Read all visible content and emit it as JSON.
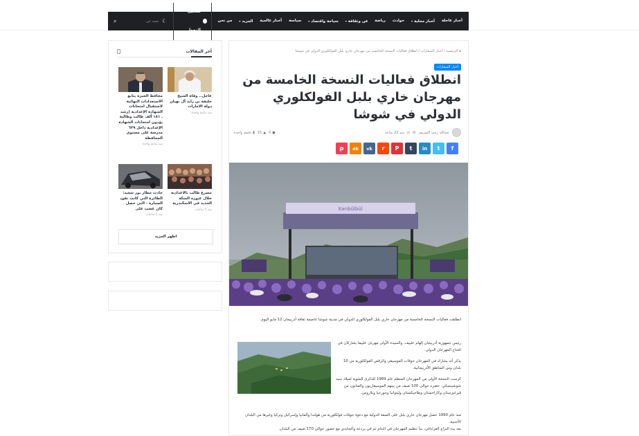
{
  "nav": {
    "menu": [
      {
        "label": "أخبار عاجلة",
        "has_caret": false
      },
      {
        "label": "أخبار محلية",
        "has_caret": true
      },
      {
        "label": "حوادث",
        "has_caret": false
      },
      {
        "label": "رياضة",
        "has_caret": false
      },
      {
        "label": "فن وثقافة",
        "has_caret": true
      },
      {
        "label": "سياحة واقتصاد",
        "has_caret": true
      },
      {
        "label": "سياسة",
        "has_caret": false
      },
      {
        "label": "أخبار عالمية",
        "has_caret": false
      },
      {
        "label": "المزيد",
        "has_caret": true
      },
      {
        "label": "من نحن",
        "has_caret": false
      }
    ],
    "login_label": "تسجيل الدخول",
    "search_placeholder": "بحث عن"
  },
  "article": {
    "breadcrumb": "الرئيسية / أخبار السفارات / انطلاق فعاليات النسخة الخامسة من مهرجان خاري بلبل الفولكلوري الدولي في شوشا",
    "category": "أخبار السفارات",
    "title": "انطلاق فعاليات النسخة الخامسة من مهرجان خاري بلبل الفولكلوري الدولي في شوشا",
    "author": "عبدالله رجب الشريف",
    "time": "منذ 22 ساعة",
    "comments": "0",
    "views": "15",
    "read_time": "دقيقة واحدة",
    "share_buttons": [
      {
        "name": "facebook",
        "glyph": "f",
        "color": "#4080ff"
      },
      {
        "name": "twitter",
        "glyph": "t",
        "color": "#40bff5"
      },
      {
        "name": "linkedin",
        "glyph": "in",
        "color": "#238cc8"
      },
      {
        "name": "tumblr",
        "glyph": "t",
        "color": "#35465c"
      },
      {
        "name": "pinterest",
        "glyph": "P",
        "color": "#e13138"
      },
      {
        "name": "reddit",
        "glyph": "r",
        "color": "#ff4500"
      },
      {
        "name": "vk",
        "glyph": "vk",
        "color": "#45668e"
      },
      {
        "name": "odnoklassniki",
        "glyph": "ok",
        "color": "#ee8208"
      },
      {
        "name": "pocket",
        "glyph": "p",
        "color": "#ef4056"
      }
    ],
    "banner_text": "Xarıbülbül",
    "intro": "انطلقت فعاليات النسخة الخامسة من مهرجان خاري بلبل الفولكلوري الدولي في مدينة شوشا عاصمة ثقافة أذربيجان 12 مايو اليوم.",
    "para1": "رئيس جمهورية أذربيجان إلهام علييف، والسيدة الأولى مهربان علييفا يشاركان في افتتاح المهرجان الدولي.",
    "para2": "يذكر أنه يشارك في المهرجان جوقات الموسيقى والرقص الفولكلورية من 10 بلدان وس المناطق الأذربيجانية.",
    "para3": "كرست النسخة الأولى من المهرجان المنظم عام 1989 للذكرى المئوية لميلاد سيد شوشينسكي. حضره حوالي 100 ضيف من بينهم الموسيقاريون والفنانون من قيرغيزستان وكازاخستان وطاجيكستان وليتوانيا وجورجيا وبلاروس.",
    "para4": "منذ عام 1990 حصل مهرجان خاري بلبل على الصفة الدولية مع دعوة جوقات فولكلورية من هولندا وألمانيا وإسرائيل وتركيا وغيرها من البلدان الأجنبية.",
    "para5": "بعد بدء النزاع الفراباغي، بدأ تنظيم المهرجان في اغدام ثم في بردعه وأغجابدي مع حضور حوالي 170 ضيف من البلدان"
  },
  "sidebar": {
    "widget_title": "آخر المقالات",
    "posts": [
      {
        "title": "عاجل.. وفاة الشيخ خليفة بن زايد آل نهيان دولة الامارات",
        "time": "منذ ساعة واحدة"
      },
      {
        "title": "محافظ الجيزة يتابع الاستعدادات النهائية لاستقبال امتحانات الشهادة الإعدادية (رشد ـ ١٨١ ألف طالب وطالبة يؤدون امتحانات الشهادة الإعدادية داخل ٦٢٩ مدرسة على مستوى المحافظة",
        "time": "منذ ساعة واحدة"
      },
      {
        "title": "مصرع طالب بالاعدادية خلال عبوره السكة الحديد في الاسكندرية",
        "time": "منذ 5 ساعات"
      },
      {
        "title": "حادث مطار بور سعيد: الطائرة التي كانت تقود السيارة - التي حصل كان غضب على",
        "time": "منذ 5 ساعات"
      }
    ],
    "more_label": "اظهر المزيد"
  }
}
